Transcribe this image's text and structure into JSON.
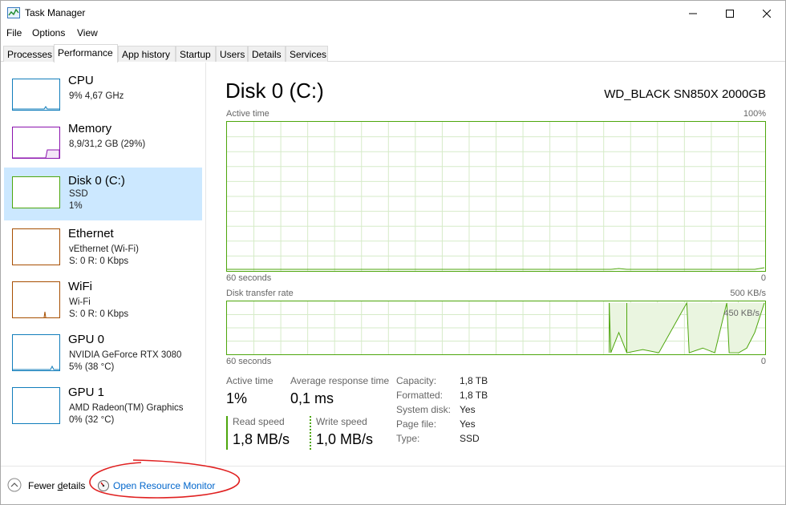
{
  "window": {
    "title": "Task Manager"
  },
  "menu": [
    "File",
    "Options",
    "View"
  ],
  "tabs": [
    {
      "label": "Processes",
      "active": false
    },
    {
      "label": "Performance",
      "active": true
    },
    {
      "label": "App history",
      "active": false
    },
    {
      "label": "Startup",
      "active": false
    },
    {
      "label": "Users",
      "active": false
    },
    {
      "label": "Details",
      "active": false
    },
    {
      "label": "Services",
      "active": false
    }
  ],
  "sidebar": [
    {
      "name": "CPU",
      "line1": "9% 4,67 GHz",
      "line2": "",
      "color": "#117dbb"
    },
    {
      "name": "Memory",
      "line1": "8,9/31,2 GB (29%)",
      "line2": "",
      "color": "#8b12ae"
    },
    {
      "name": "Disk 0 (C:)",
      "line1": "SSD",
      "line2": "1%",
      "color": "#4da60c"
    },
    {
      "name": "Ethernet",
      "line1": "vEthernet (Wi-Fi)",
      "line2": "S: 0 R: 0 Kbps",
      "color": "#a74f01"
    },
    {
      "name": "WiFi",
      "line1": "Wi-Fi",
      "line2": "S: 0 R: 0 Kbps",
      "color": "#a74f01"
    },
    {
      "name": "GPU 0",
      "line1": "NVIDIA GeForce RTX 3080",
      "line2": "5% (38 °C)",
      "color": "#117dbb"
    },
    {
      "name": "GPU 1",
      "line1": "AMD Radeon(TM) Graphics",
      "line2": "0% (32 °C)",
      "color": "#117dbb"
    }
  ],
  "disk": {
    "title": "Disk 0 (C:)",
    "model": "WD_BLACK SN850X 2000GB",
    "active_graph": {
      "label": "Active time",
      "max": "100%",
      "time": "60 seconds",
      "min": "0"
    },
    "transfer_graph": {
      "label": "Disk transfer rate",
      "max": "500 KB/s",
      "mid": "450 KB/s",
      "time": "60 seconds",
      "min": "0"
    },
    "stats": {
      "active_label": "Active time",
      "active_value": "1%",
      "response_label": "Average response time",
      "response_value": "0,1 ms",
      "read_label": "Read speed",
      "read_value": "1,8 MB/s",
      "write_label": "Write speed",
      "write_value": "1,0 MB/s"
    },
    "props": [
      {
        "label": "Capacity:",
        "value": "1,8 TB"
      },
      {
        "label": "Formatted:",
        "value": "1,8 TB"
      },
      {
        "label": "System disk:",
        "value": "Yes"
      },
      {
        "label": "Page file:",
        "value": "Yes"
      },
      {
        "label": "Type:",
        "value": "SSD"
      }
    ]
  },
  "footer": {
    "fewer_pre": "Fewer ",
    "fewer_u": "d",
    "fewer_post": "etails",
    "resmon": "Open Resource Monitor"
  },
  "accent": "#4da60c",
  "annotation_color": "#e02020"
}
